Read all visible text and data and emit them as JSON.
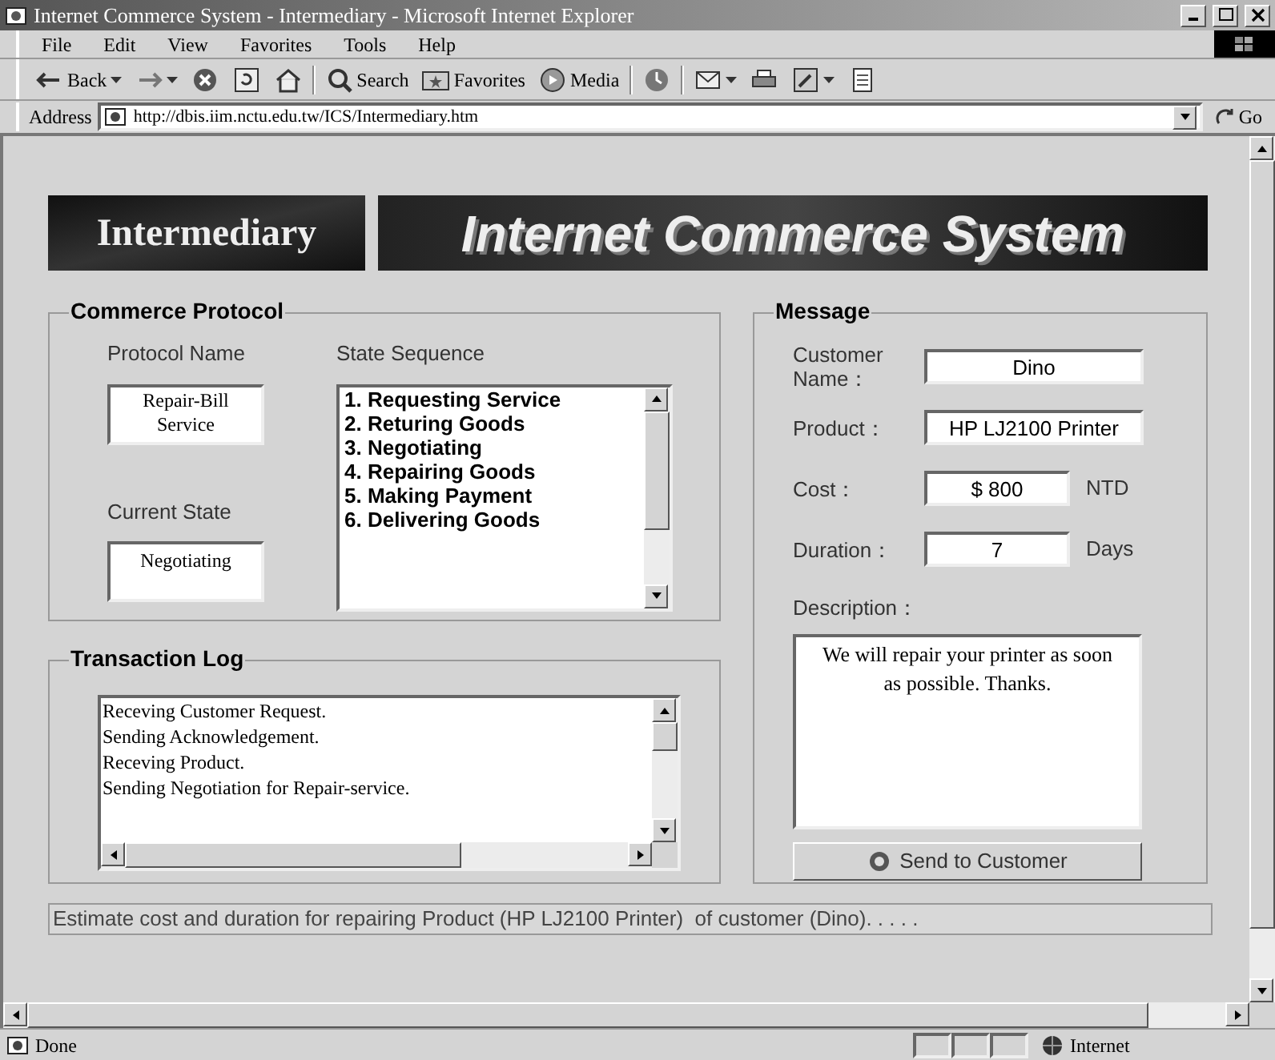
{
  "window": {
    "title": "Internet Commerce System - Intermediary - Microsoft Internet Explorer"
  },
  "menu": [
    "File",
    "Edit",
    "View",
    "Favorites",
    "Tools",
    "Help"
  ],
  "toolbar": [
    {
      "kind": "back",
      "label": "Back"
    },
    {
      "kind": "forward"
    },
    {
      "kind": "stop"
    },
    {
      "kind": "refresh"
    },
    {
      "kind": "home"
    },
    {
      "kind": "search",
      "label": "Search"
    },
    {
      "kind": "favorites",
      "label": "Favorites"
    },
    {
      "kind": "media",
      "label": "Media"
    },
    {
      "kind": "history"
    },
    {
      "kind": "mail"
    },
    {
      "kind": "print"
    },
    {
      "kind": "edit"
    },
    {
      "kind": "discuss"
    }
  ],
  "address": {
    "label": "Address",
    "url": "http://dbis.iim.nctu.edu.tw/ICS/Intermediary.htm",
    "go": "Go"
  },
  "banner": {
    "left": "Intermediary",
    "right": "Internet Commerce System"
  },
  "commerce_protocol": {
    "title": "Commerce Protocol",
    "protocol_name_label": "Protocol Name",
    "protocol_name": "Repair-Bill Service",
    "current_state_label": "Current State",
    "current_state": "Negotiating",
    "state_sequence_label": "State Sequence",
    "states": [
      "1. Requesting Service",
      "2. Returing Goods",
      "3. Negotiating",
      "4. Repairing Goods",
      "5. Making Payment",
      "6. Delivering Goods"
    ]
  },
  "transaction_log": {
    "title": "Transaction Log",
    "lines": [
      "Receving Customer Request.",
      "Sending Acknowledgement.",
      "Receving Product.",
      "Sending Negotiation for Repair-service."
    ]
  },
  "message": {
    "title": "Message",
    "fields": [
      {
        "label": "Customer Name：",
        "value": "Dino"
      },
      {
        "label": "Product：",
        "value": "HP LJ2100 Printer"
      },
      {
        "label": "Cost：",
        "value": "$ 800",
        "unit": "NTD"
      },
      {
        "label": "Duration：",
        "value": "7",
        "unit": "Days"
      }
    ],
    "description_label": "Description：",
    "description": "We will repair your printer as soon as possible. Thanks.",
    "send_button": "Send to Customer"
  },
  "status_message": "Estimate cost and duration for repairing Product (HP LJ2100 Printer)  of customer (Dino). . . . .",
  "status_bar": {
    "text": "Done",
    "zone": "Internet"
  }
}
